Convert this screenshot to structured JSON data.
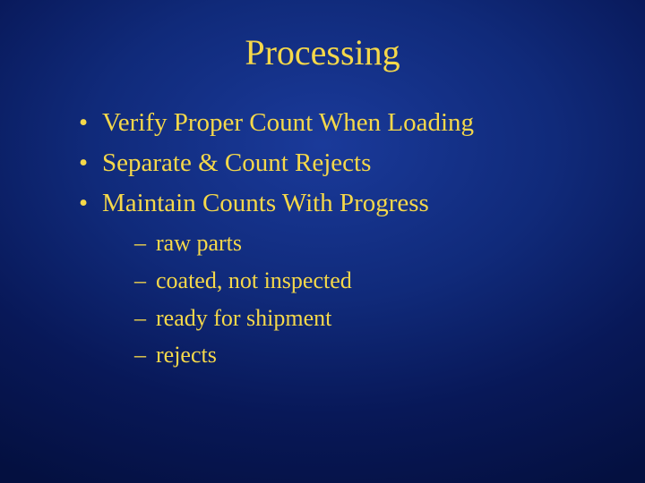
{
  "title": "Processing",
  "bullets": [
    {
      "text": "Verify Proper Count When Loading"
    },
    {
      "text": "Separate & Count Rejects"
    },
    {
      "text": "Maintain Counts With Progress",
      "sub": [
        "raw parts",
        "coated, not inspected",
        "ready for shipment",
        "rejects"
      ]
    }
  ]
}
